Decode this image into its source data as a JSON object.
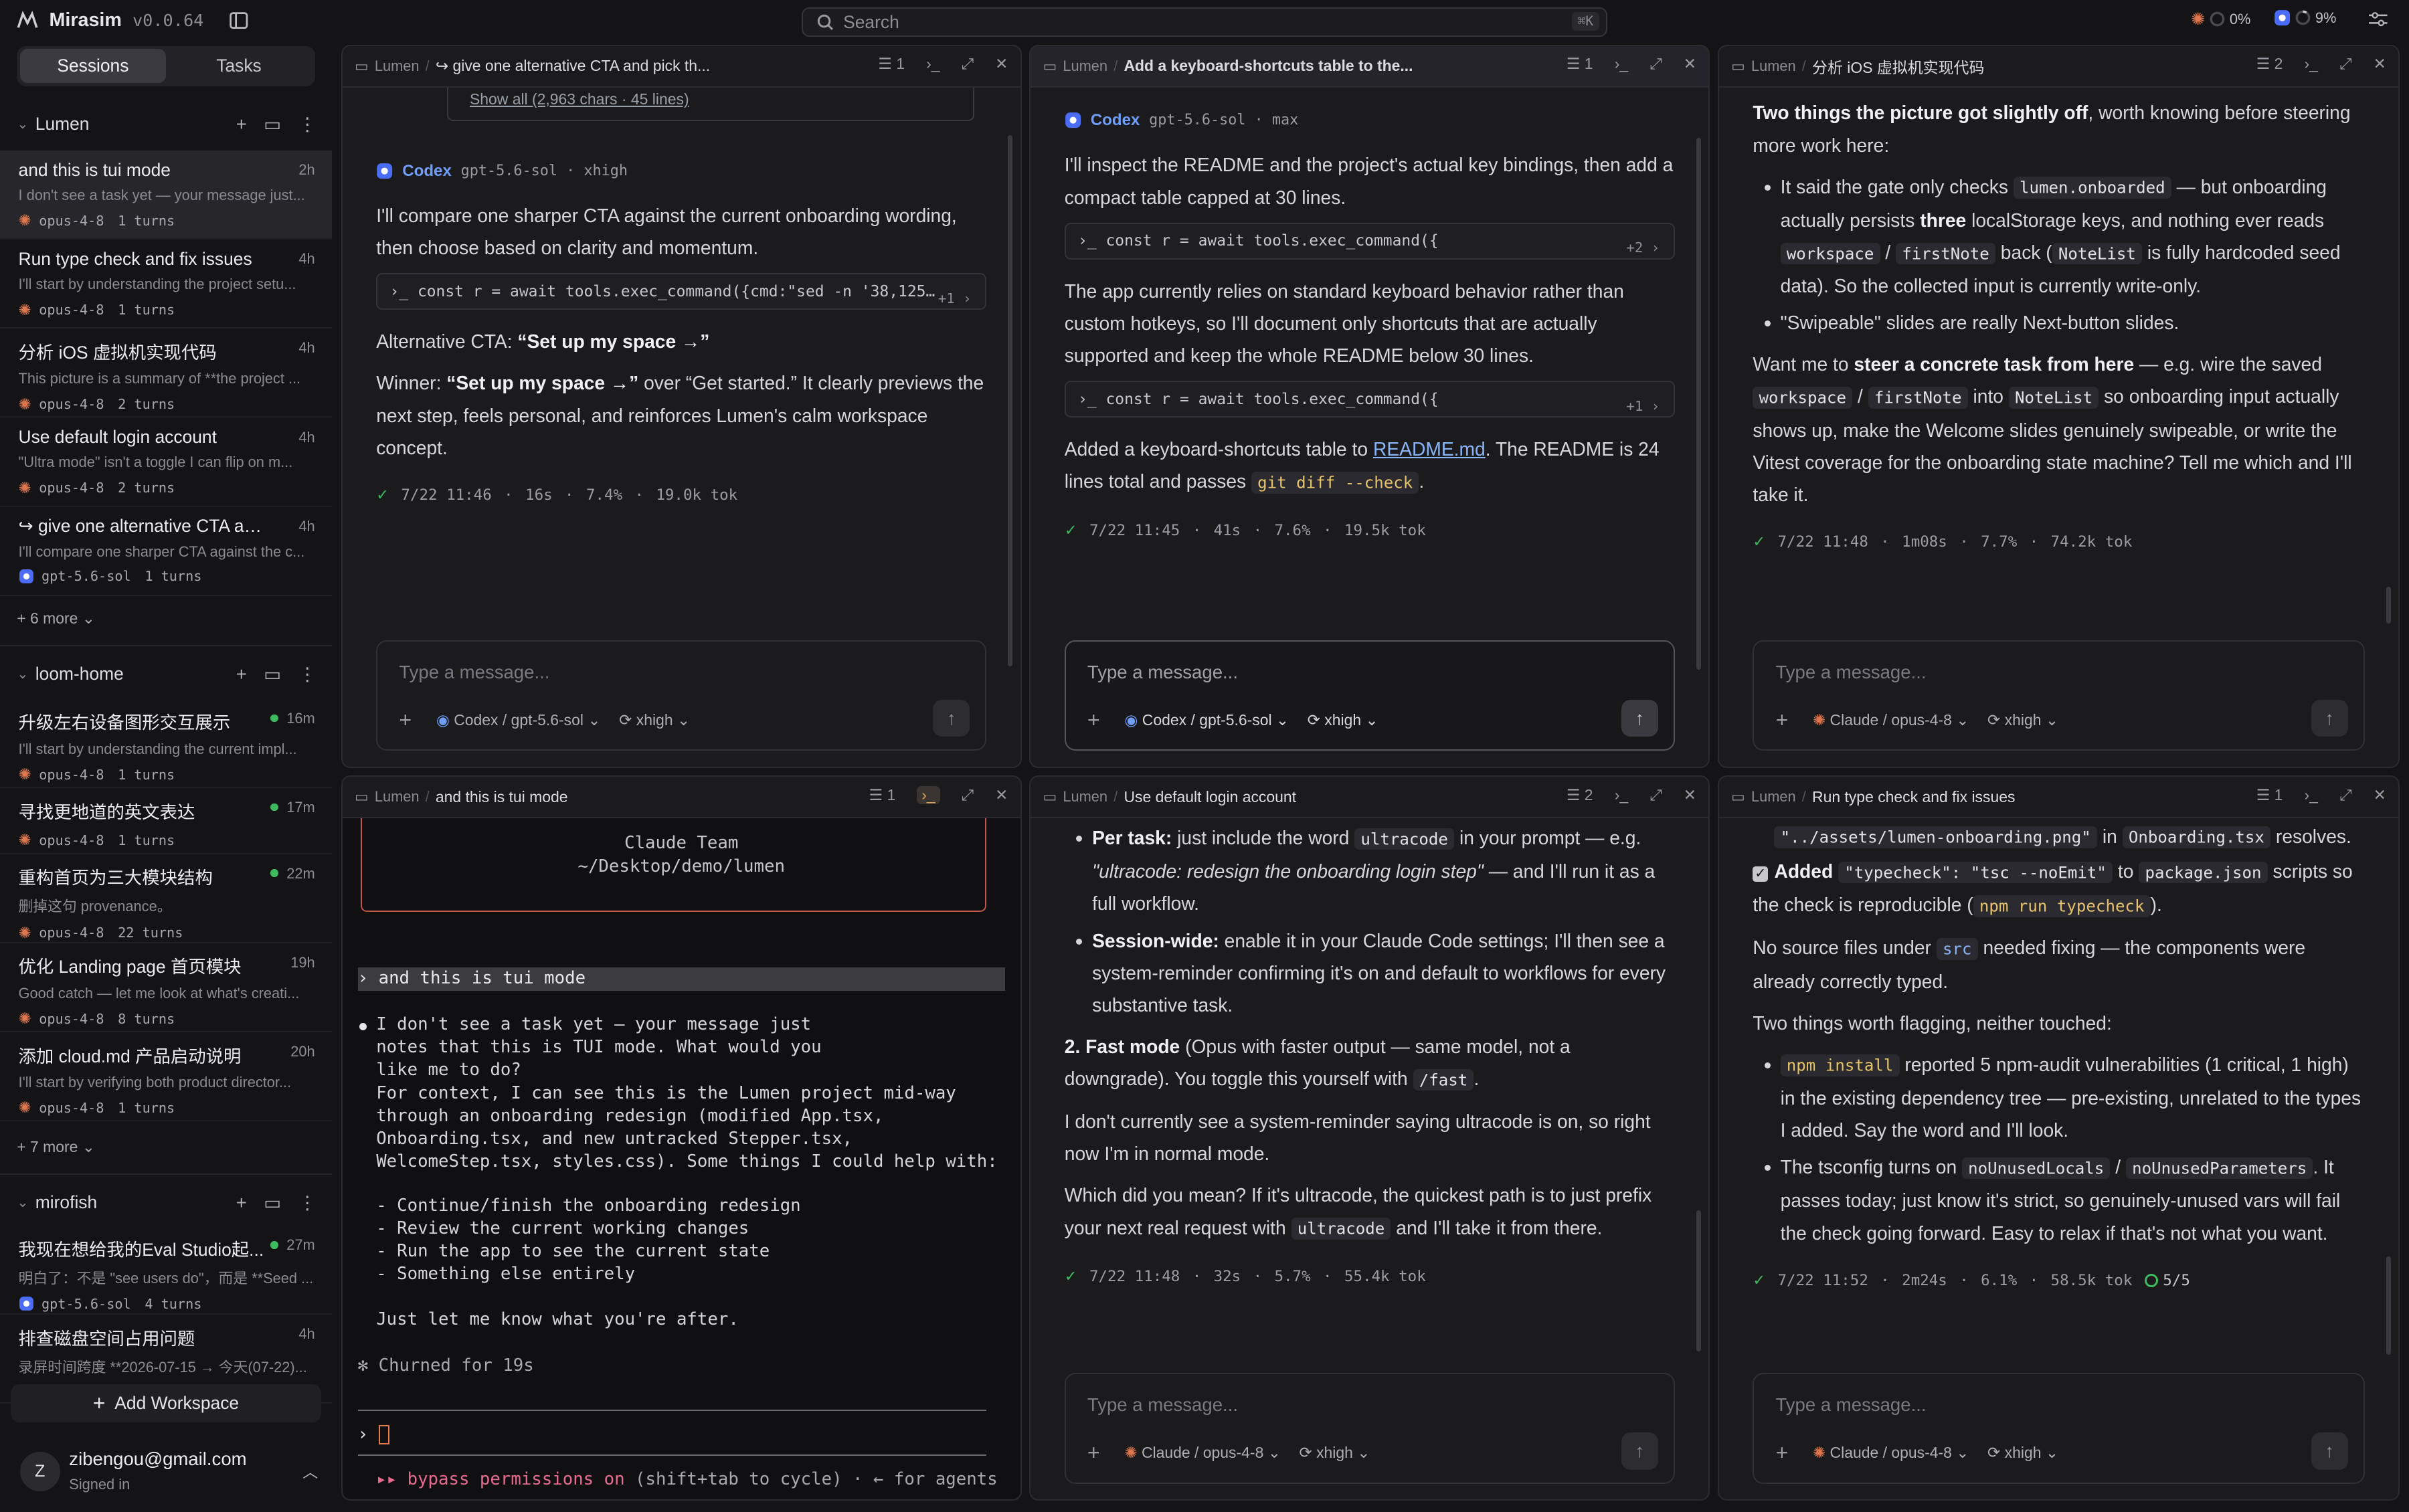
{
  "app": {
    "name": "Mirasim",
    "version": "v0.0.64",
    "search_placeholder": "Search",
    "search_shortcut": "⌘K",
    "usage_claude": "0%",
    "usage_codex": "9%"
  },
  "sidebar": {
    "tabs": [
      "Sessions",
      "Tasks"
    ],
    "workspaces": [
      {
        "name": "Lumen",
        "more": "+ 6 more",
        "sessions": [
          {
            "title": "and this is tui mode",
            "ago": "2h",
            "preview": "I don't see a task yet — your message just...",
            "model": "opus-4-8",
            "turns": "1 turns",
            "agent": "claude"
          },
          {
            "title": "Run type check and fix issues",
            "ago": "4h",
            "preview": "I'll start by understanding the project setu...",
            "model": "opus-4-8",
            "turns": "1 turns",
            "agent": "claude"
          },
          {
            "title": "分析 iOS 虚拟机实现代码",
            "ago": "4h",
            "preview": "This picture is a summary of **the project ...",
            "model": "opus-4-8",
            "turns": "2 turns",
            "agent": "claude"
          },
          {
            "title": "Use default login account",
            "ago": "4h",
            "preview": "\"Ultra mode\" isn't a toggle I can flip on m...",
            "model": "opus-4-8",
            "turns": "2 turns",
            "agent": "claude"
          },
          {
            "title": "↪ give one alternative CTA and ...",
            "ago": "4h",
            "preview": "I'll compare one sharper CTA against the c...",
            "model": "gpt-5.6-sol",
            "turns": "1 turns",
            "agent": "codex"
          }
        ]
      },
      {
        "name": "loom-home",
        "more": "+ 7 more",
        "sessions": [
          {
            "title": "升级左右设备图形交互展示",
            "ago": "16m",
            "preview": "I'll start by understanding the current impl...",
            "model": "opus-4-8",
            "turns": "1 turns",
            "agent": "claude",
            "live": true
          },
          {
            "title": "寻找更地道的英文表达",
            "ago": "17m",
            "preview": "",
            "model": "opus-4-8",
            "turns": "1 turns",
            "agent": "claude",
            "live": true
          },
          {
            "title": "重构首页为三大模块结构",
            "ago": "22m",
            "preview": "删掉这句 provenance。",
            "model": "opus-4-8",
            "turns": "22 turns",
            "agent": "claude",
            "live": true
          },
          {
            "title": "优化 Landing page 首页模块",
            "ago": "19h",
            "preview": "Good catch — let me look at what's creati...",
            "model": "opus-4-8",
            "turns": "8 turns",
            "agent": "claude"
          },
          {
            "title": "添加 cloud.md 产品启动说明",
            "ago": "20h",
            "preview": "I'll start by verifying both product director...",
            "model": "opus-4-8",
            "turns": "1 turns",
            "agent": "claude"
          }
        ]
      },
      {
        "name": "mirofish",
        "sessions": [
          {
            "title": "我现在想给我的Eval Studio起...",
            "ago": "27m",
            "preview": "明白了：不是 \"see users do\"，而是 **Seed ...",
            "model": "gpt-5.6-sol",
            "turns": "4 turns",
            "agent": "codex",
            "live": true
          },
          {
            "title": "排查磁盘空间占用问题",
            "ago": "4h",
            "preview": "录屏时间跨度 **2026-07-15 → 今天(07-22)...",
            "model": "",
            "turns": "",
            "agent": ""
          }
        ]
      }
    ],
    "add_workspace": "Add Workspace",
    "user_email": "zibengou@gmail.com",
    "user_status": "Signed in",
    "user_initial": "Z"
  },
  "panes": {
    "p1": {
      "project": "Lumen",
      "title": "↪ give one alternative CTA and pick th...",
      "count": "1",
      "show_all": "Show all (2,963 chars · 45 lines)",
      "agent": "Codex",
      "model": "gpt-5.6-sol · xhigh",
      "intro": "I'll compare one sharper CTA against the current onboarding wording, then choose based on clarity and momentum.",
      "tool": "const r = await tools.exec_command({cmd:\"sed -n '38,125…",
      "tool_more": "+1",
      "alt_label": "Alternative CTA: ",
      "alt_value": "“Set up my space →”",
      "winner_label": "Winner: ",
      "winner_value": "“Set up my space →”",
      "winner_rest": " over “Get started.” It clearly previews the next step, feels personal, and reinforces Lumen's calm workspace concept.",
      "meta": [
        "7/22 11:46",
        "16s",
        "7.4%",
        "19.0k tok"
      ],
      "placeholder": "Type a message...",
      "agent_sel": "Codex / gpt-5.6-sol",
      "effort": "xhigh"
    },
    "p2": {
      "project": "Lumen",
      "title": "Add a keyboard-shortcuts table to the...",
      "count": "1",
      "agent": "Codex",
      "model": "gpt-5.6-sol · max",
      "intro": "I'll inspect the README and the project's actual key bindings, then add a compact table capped at 30 lines.",
      "tool1": "const r = await tools.exec_command({",
      "tool1_more": "+2",
      "mid": "The app currently relies on standard keyboard behavior rather than custom hotkeys, so I'll document only shortcuts that are actually supported and keep the whole README below 30 lines.",
      "tool2": "const r = await tools.exec_command({",
      "tool2_more": "+1",
      "done_a": "Added a keyboard-shortcuts table to ",
      "done_link": "README.md",
      "done_b": ". The README is 24 lines total and passes ",
      "done_code": "git diff --check",
      "done_c": ".",
      "meta": [
        "7/22 11:45",
        "41s",
        "7.6%",
        "19.5k tok"
      ],
      "placeholder": "Type a message...",
      "agent_sel": "Codex / gpt-5.6-sol",
      "effort": "xhigh"
    },
    "p3": {
      "project": "Lumen",
      "title": "分析 iOS 虚拟机实现代码",
      "count": "2",
      "lead_b": "Two things the picture got slightly off",
      "lead": ", worth knowing before steering more work here:",
      "b1_a": "It said the gate only checks ",
      "b1_c1": "lumen.onboarded",
      "b1_b": " — but onboarding actually persists ",
      "b1_bold": "three",
      "b1_c": " localStorage keys, and nothing ever reads ",
      "b1_c2": "workspace",
      "b1_sep": " / ",
      "b1_c3": "firstNote",
      "b1_d": " back (",
      "b1_c4": "NoteList",
      "b1_e": " is fully hardcoded seed data). So the collected input is currently write-only.",
      "b2": "\"Swipeable\" slides are really Next-button slides.",
      "want_a": "Want me to ",
      "want_b": "steer a concrete task from here",
      "want_c": " — e.g. wire the saved ",
      "want_c1": "workspace",
      "want_sep": " / ",
      "want_c2": "firstNote",
      "want_d": " into ",
      "want_c3": "NoteList",
      "want_e": " so onboarding input actually shows up, make the Welcome slides genuinely swipeable, or write the Vitest coverage for the onboarding state machine? Tell me which and I'll take it.",
      "meta": [
        "7/22 11:48",
        "1m08s",
        "7.7%",
        "74.2k tok"
      ],
      "placeholder": "Type a message...",
      "agent_sel": "Claude / opus-4-8",
      "effort": "xhigh"
    },
    "p4": {
      "project": "Lumen",
      "title": "and this is tui mode",
      "count": "1",
      "team": "Claude Team",
      "path": "~/Desktop/demo/lumen",
      "prompt": "› and this is tui mode",
      "reply": "I don't see a task yet — your message just\nnotes that this is TUI mode. What would you\nlike me to do?",
      "ctx": "For context, I can see this is the Lumen project mid-way\nthrough an onboarding redesign (modified App.tsx,\nOnboarding.tsx, and new untracked Stepper.tsx,\nWelcomeStep.tsx, styles.css). Some things I could help with:",
      "list": "- Continue/finish the onboarding redesign\n- Review the current working changes\n- Run the app to see the current state\n- Something else entirely",
      "end": "Just let me know what you're after.",
      "churn": "✻ Churned for 19s",
      "cursor": "›",
      "mode_a": "▸▸ bypass permissions on",
      "mode_b": " (shift+tab to cycle) · ← for agents"
    },
    "p5": {
      "project": "Lumen",
      "title": "Use default login account",
      "count": "2",
      "pt_b": "Per task:",
      "pt_a": " just include the word ",
      "pt_code": "ultracode",
      "pt_c": " in your prompt — e.g. ",
      "pt_i": "\"ultracode: redesign the onboarding login step\"",
      "pt_d": " — and I'll run it as a full workflow.",
      "sw_b": "Session-wide:",
      "sw": " enable it in your Claude Code settings; I'll then see a system-reminder confirming it's on and default to workflows for every substantive task.",
      "fm_b": "2. Fast mode",
      "fm": " (Opus with faster output — same model, not a downgrade). You toggle this yourself with ",
      "fm_code": "/fast",
      "fm_end": ".",
      "p1": "I don't currently see a system-reminder saying ultracode is on, so right now I'm in normal mode.",
      "p2_a": "Which did you mean? If it's ultracode, the quickest path is to just prefix your next real request with ",
      "p2_code": "ultracode",
      "p2_b": " and I'll take it from there.",
      "meta": [
        "7/22 11:48",
        "32s",
        "5.7%",
        "55.4k tok"
      ],
      "placeholder": "Type a message...",
      "agent_sel": "Claude / opus-4-8",
      "effort": "xhigh"
    },
    "p6": {
      "project": "Lumen",
      "title": "Run type check and fix issues",
      "count": "1",
      "l1_code": "\"../assets/lumen-onboarding.png\"",
      "l1_a": " in ",
      "l1_code2": "Onboarding.tsx",
      "l1_b": " resolves.",
      "add_b": "Added ",
      "add_code": "\"typecheck\": \"tsc --noEmit\"",
      "add_a": " to ",
      "add_code2": "package.json",
      "add_c": " scripts so the check is reproducible (",
      "add_code3": "npm run typecheck",
      "add_d": ").",
      "nosrc_a": "No source files under ",
      "nosrc_code": "src",
      "nosrc_b": " needed fixing — the components were already correctly typed.",
      "flag": "Two things worth flagging, neither touched:",
      "f1_code": "npm install",
      "f1": " reported 5 npm-audit vulnerabilities (1 critical, 1 high) in the existing dependency tree — pre-existing, unrelated to the types I added. Say the word and I'll look.",
      "f2_a": "The tsconfig turns on ",
      "f2_c1": "noUnusedLocals",
      "f2_sep": " / ",
      "f2_c2": "noUnusedParameters",
      "f2_b": ". It passes today; just know it's strict, so genuinely-unused vars will fail the check going forward. Easy to relax if that's not what you want.",
      "meta": [
        "7/22 11:52",
        "2m24s",
        "6.1%",
        "58.5k tok"
      ],
      "tasks": "5/5",
      "placeholder": "Type a message...",
      "agent_sel": "Claude / opus-4-8",
      "effort": "xhigh"
    }
  }
}
